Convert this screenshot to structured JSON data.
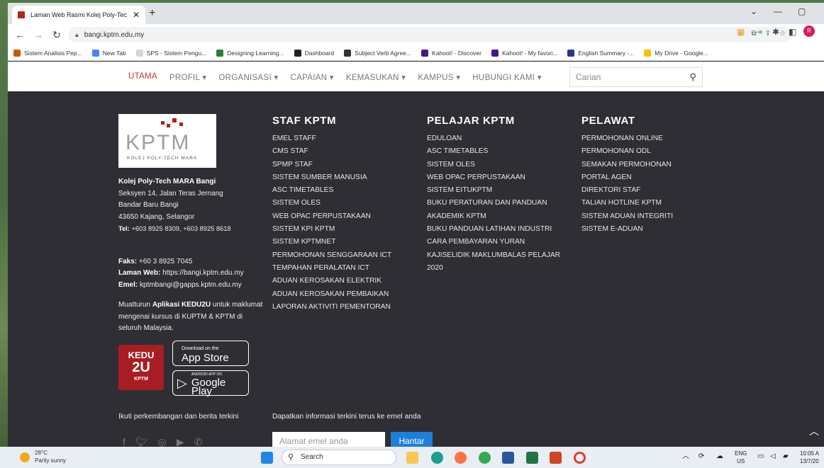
{
  "browser": {
    "tab_title": "Laman Web Rasmi Kolej Poly-Tec",
    "tab_close": "✕",
    "new_tab": "+",
    "url": "bangi.kptm.edu.my",
    "bookmarks": [
      {
        "label": "Sistem Analisis Pep...",
        "color": "#d35400"
      },
      {
        "label": "New Tab",
        "color": "#4285f4"
      },
      {
        "label": "SPS - Sistem Pengu...",
        "color": "#cfd8dc"
      },
      {
        "label": "Designing Learning...",
        "color": "#2e7d32"
      },
      {
        "label": "Dashboard",
        "color": "#212121"
      },
      {
        "label": "Subject Verb Agree...",
        "color": "#333333"
      },
      {
        "label": "Kahoot! - Discover",
        "color": "#46178f"
      },
      {
        "label": "Kahoot! - My favori...",
        "color": "#46178f"
      },
      {
        "label": "English Summary -...",
        "color": "#283593"
      },
      {
        "label": "My Drive - Google...",
        "color": "#fbbc04"
      }
    ]
  },
  "site_nav": {
    "items": [
      "UTAMA",
      "PROFIL ▾",
      "ORGANISASI ▾",
      "CAPAIAN ▾",
      "KEMASUKAN ▾",
      "KAMPUS ▾",
      "HUBUNGI KAMI ▾"
    ],
    "search_placeholder": "Carian"
  },
  "logo": {
    "text": "KPTM",
    "subtext": "KOLEJ POLY-TECH MARA"
  },
  "contact": {
    "name": "Kolej Poly-Tech MARA Bangi",
    "address1": "Seksyen 14, Jalan Teras Jernang",
    "address2": "Bandar Baru Bangi",
    "address3": "43650 Kajang, Selangor",
    "tel_label": "Tel:",
    "tel": "+603 8925 8309, +603 8925 8618",
    "fax_label": "Faks:",
    "fax": "+60 3 8925 7045",
    "web_label": "Laman Web:",
    "web": "https://bangi.kptm.edu.my",
    "email_label": "Emel:",
    "email": "kptmbangi@gapps.kptm.edu.my",
    "app_pre": "Muatturun",
    "app_name": "Aplikasi KEDU2U",
    "app_post": "untuk maklumat mengenai kursus di KUPTM & KPTM di seluruh Malaysia."
  },
  "kedu_logo": {
    "line1": "KEDU",
    "line2": "2U",
    "line3": "KPTM"
  },
  "app_store": {
    "small": "Download on the",
    "big": "App Store"
  },
  "google_play": {
    "small": "ANDROID APP ON",
    "big": "Google Play"
  },
  "staf": {
    "title": "STAF KPTM",
    "links": [
      "EMEL STAFF",
      "CMS STAF",
      "SPMP STAF",
      "SISTEM SUMBER MANUSIA",
      "ASC TIMETABLES",
      "SISTEM OLES",
      "WEB OPAC PERPUSTAKAAN",
      "SISTEM KPI KPTM",
      "SISTEM KPTMNET",
      "PERMOHONAN SENGGARAAN ICT",
      "TEMPAHAN PERALATAN ICT",
      "ADUAN KEROSAKAN ELEKTRIK",
      "ADUAN KEROSAKAN PEMBAIKAN",
      "LAPORAN AKTIVITI PEMENTORAN"
    ]
  },
  "pelajar": {
    "title": "PELAJAR KPTM",
    "links": [
      "EDULOAN",
      "ASC TIMETABLES",
      "SISTEM OLES",
      "WEB OPAC PERPUSTAKAAN",
      "SISTEM EITUKPTM",
      "BUKU PERATURAN DAN PANDUAN",
      "AKADEMIK KPTM",
      "BUKU PANDUAN LATIHAN INDUSTRI",
      "CARA PEMBAYARAN YURAN",
      "KAJISELIDIK MAKLUMBALAS PELAJAR",
      "2020"
    ]
  },
  "pelawat": {
    "title": "PELAWAT",
    "links": [
      "PERMOHONAN ONLINE",
      "PERMOHONAN ODL",
      "SEMAKAN PERMOHONAN",
      "PORTAL AGEN",
      "DIREKTORI STAF",
      "TALIAN HOTLINE KPTM",
      "SISTEM ADUAN INTEGRITI",
      "SISTEM E-ADUAN"
    ]
  },
  "follow_text": "Ikuti perkembangan dan berita terkini",
  "newsletter_text": "Dapatkan informasi terkini terus ke emel anda",
  "email_placeholder": "Alamat emel anda",
  "submit_label": "Hantar",
  "taskbar": {
    "temp": "28°C",
    "weather": "Partly sunny",
    "search": "Search",
    "lang1": "ENG",
    "lang2": "US",
    "time": "10:05 A",
    "date": "13/7/20"
  }
}
